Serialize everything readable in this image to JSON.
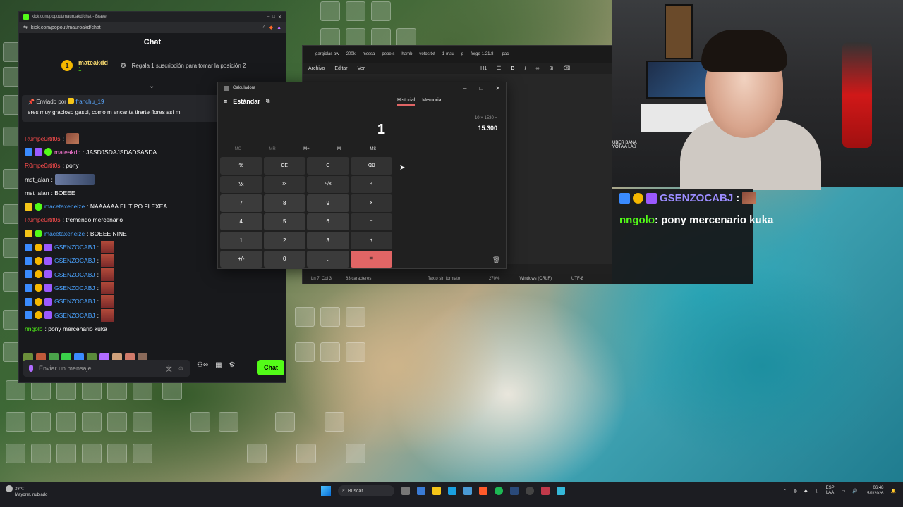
{
  "browser": {
    "tab_url_short": "kick.com/popout/mauroakd/chat - Brave",
    "url": "kick.com/popout/mauroakd/chat"
  },
  "chat": {
    "header": "Chat",
    "top_sub": {
      "rank": "1",
      "user": "mateakdd",
      "meta": "1",
      "text": "Regala 1 suscripción para tomar la posición 2"
    },
    "pinned": {
      "label": "Enviado por",
      "user": "franchu_19",
      "message": "eres muy gracioso gaspi, como m encanta tirarte flores así m"
    },
    "messages": [
      {
        "user": "R0mpe0rtit0s",
        "text": ":",
        "emote": "emote"
      },
      {
        "user": "mateakdd",
        "text": ": JASDJSDAJSDADSASDA"
      },
      {
        "user": "R0mpe0rtit0s",
        "text": ": pony"
      },
      {
        "user": "mst_alan",
        "text": ":",
        "emote": "wide"
      },
      {
        "user": "mst_alan",
        "text": ": BOEEE"
      },
      {
        "user": "macetaxeneize",
        "text": ": NAAAAAA EL TIPO FLEXEA"
      },
      {
        "user": "R0mpe0rtit0s",
        "text": ": tremendo mercenario"
      },
      {
        "user": "macetaxeneize",
        "text": ": BOEEE NINE"
      },
      {
        "user": "GSENZOCABJ",
        "text": ":"
      },
      {
        "user": "GSENZOCABJ",
        "text": ":"
      },
      {
        "user": "GSENZOCABJ",
        "text": ":"
      },
      {
        "user": "GSENZOCABJ",
        "text": ":"
      },
      {
        "user": "GSENZOCABJ",
        "text": ":"
      },
      {
        "user": "GSENZOCABJ",
        "text": ":"
      },
      {
        "user": "nngolo",
        "text": ": pony mercenario kuka"
      }
    ],
    "input_placeholder": "Enviar un mensaje",
    "send_label": "Chat"
  },
  "notepad": {
    "tabs": [
      "gargiolas aw",
      "200k",
      "messa",
      "pepe s",
      "hamb",
      "votos.txt",
      "1-mau",
      "g",
      "forge-1.21.8-",
      "pac"
    ],
    "menu": [
      "Archivo",
      "Editar",
      "Ver"
    ],
    "heading_level": "H1",
    "status": {
      "position": "Ln 7, Col 3",
      "chars": "63 caracteres",
      "format": "Texto sin formato",
      "zoom": "270%",
      "eol": "Windows (CRLF)",
      "encoding": "UTF-8"
    }
  },
  "calculator": {
    "title": "Calculadora",
    "mode": "Estándar",
    "tabs": {
      "history": "Historial",
      "memory": "Memoria"
    },
    "display": "1",
    "history_expr": "10 × 1530 =",
    "history_result": "15.300",
    "memory_keys": [
      "MC",
      "MR",
      "M+",
      "M-",
      "MS"
    ],
    "keys": [
      "%",
      "CE",
      "C",
      "⌫",
      "⅟x",
      "x²",
      "²√x",
      "÷",
      "7",
      "8",
      "9",
      "×",
      "4",
      "5",
      "6",
      "−",
      "1",
      "2",
      "3",
      "+",
      "+/-",
      "0",
      ",",
      "="
    ]
  },
  "overlay": {
    "line1_user": "GSENZOCABJ",
    "line1_text": ":",
    "line2_user": "nngolo",
    "line2_text": ": pony mercenario kuka",
    "small_text1": "UBER BANA",
    "small_text2": "VOTA A LAS"
  },
  "taskbar": {
    "weather_temp": "28°C",
    "weather_desc": "Mayorm. nublado",
    "search_label": "Buscar",
    "lang_top": "ESP",
    "lang_bottom": "LAA",
    "time": "06:48",
    "date": "15/1/2026"
  },
  "colors": {
    "kick_green": "#53fc18",
    "calc_equals": "#e06565",
    "sub_gold": "#f5b800"
  }
}
